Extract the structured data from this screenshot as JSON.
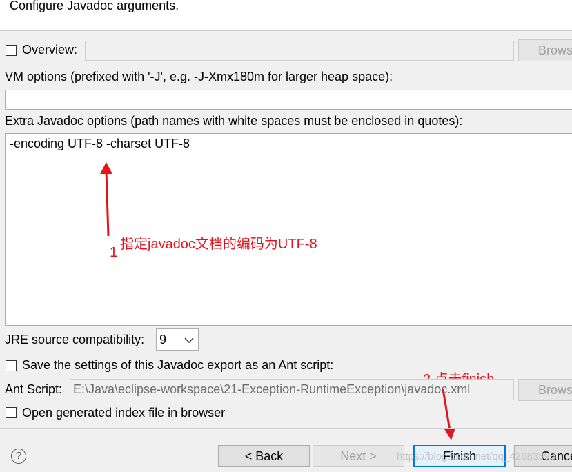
{
  "header": {
    "title": "Configure Javadoc arguments."
  },
  "overview": {
    "label": "Overview:",
    "value": "",
    "browse_label": "Brows"
  },
  "vm_options": {
    "label": "VM options (prefixed with '-J', e.g. -J-Xmx180m for larger heap space):",
    "value": ""
  },
  "extra_options": {
    "label": "Extra Javadoc options (path names with white spaces must be enclosed in quotes):",
    "value": "-encoding UTF-8 -charset UTF-8 "
  },
  "jre": {
    "label": "JRE source compatibility:",
    "selected": "9"
  },
  "save_ant": {
    "label": "Save the settings of this Javadoc export as an Ant script:"
  },
  "ant_script": {
    "label": "Ant Script:",
    "value": "E:\\Java\\eclipse-workspace\\21-Exception-RuntimeException\\javadoc.xml",
    "browse_label": "Brows"
  },
  "open_index": {
    "label": "Open generated index file in browser"
  },
  "buttons": {
    "help": "?",
    "back": "< Back",
    "next": "Next >",
    "finish": "Finish",
    "cancel": "Cance"
  },
  "annotations": {
    "a1_text": "指定javadoc文档的编码为UTF-8",
    "a1_num": "1",
    "a2_text": "2 点击finish"
  },
  "watermark": "https://blog.csdn.net/qq_42683393",
  "colors": {
    "annotation": "#e5141c",
    "default_button_border": "#0078d7"
  }
}
